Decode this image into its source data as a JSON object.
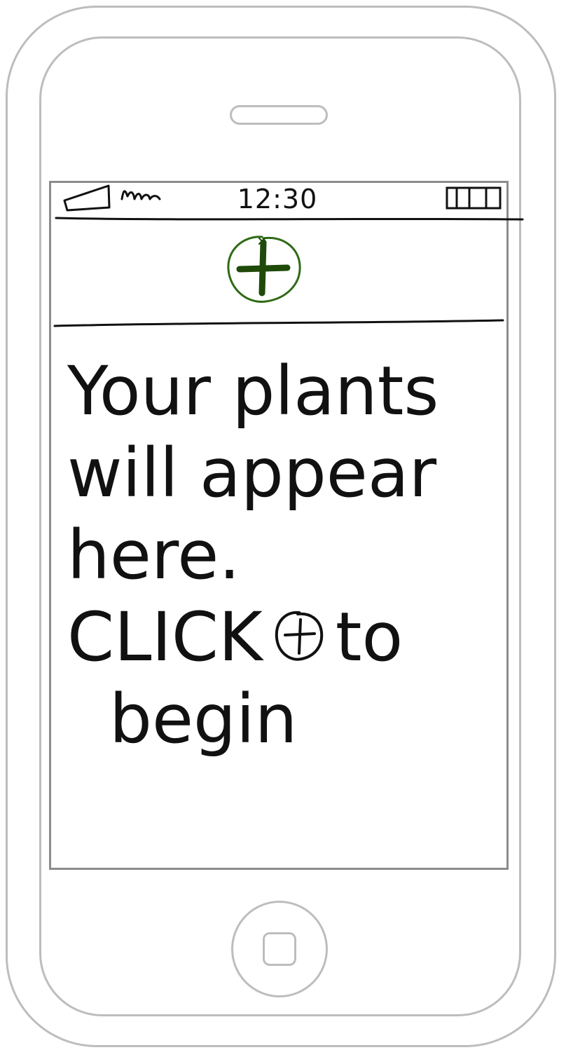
{
  "status_bar": {
    "time": "12:30",
    "signal_icon": "signal-bars-icon",
    "battery_icon": "battery-icon"
  },
  "toolbar": {
    "add_icon": "plus-circle-icon",
    "add_color": "#2e6b14",
    "add_fill": "#1f4a0a"
  },
  "empty_state": {
    "line1": "Your plants",
    "line2": "will appear",
    "line3": "here.",
    "line4_before": "CLICK",
    "line4_after": "to",
    "line5": "begin",
    "inline_icon": "plus-circle-icon"
  },
  "colors": {
    "frame": "#bdbdbd",
    "ink": "#111111",
    "accent": "#2e6b14"
  }
}
